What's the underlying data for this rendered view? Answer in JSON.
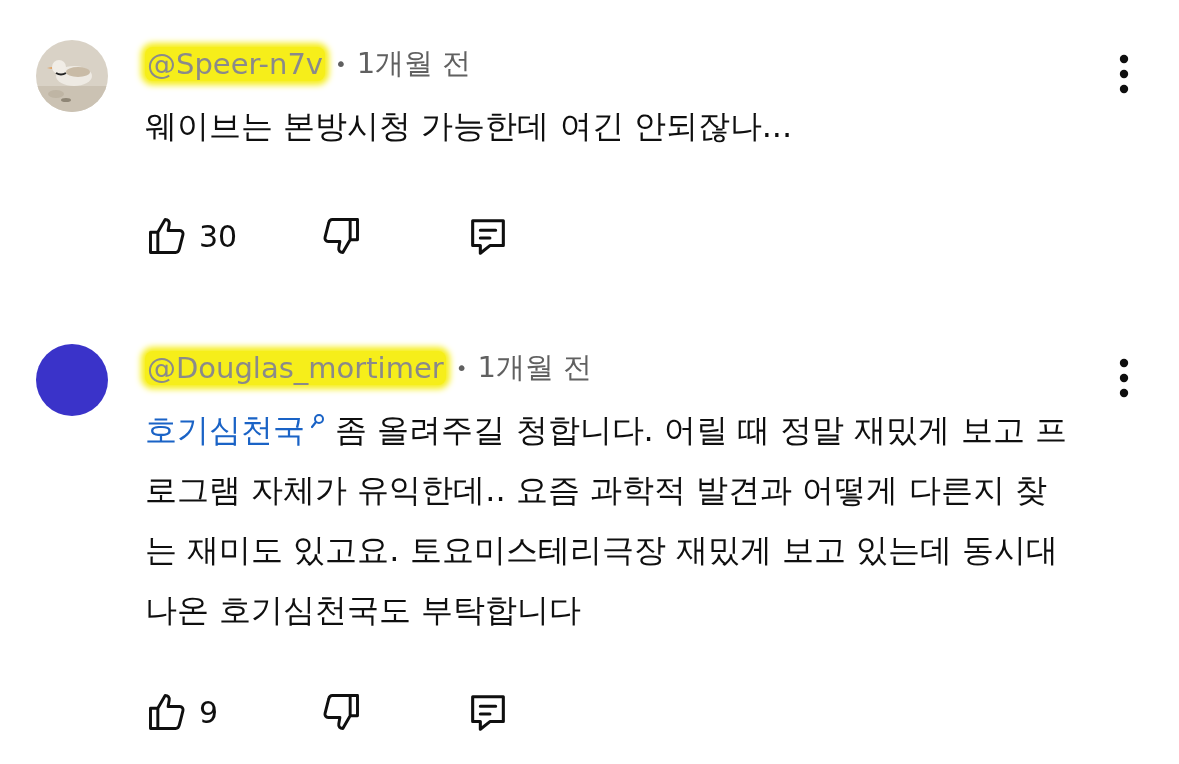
{
  "comments": [
    {
      "author": "@Speer-n7v",
      "time": "1개월 전",
      "avatar": {
        "kind": "picture"
      },
      "body": [
        {
          "kind": "text",
          "text": "웨이브는 본방시청 가능한데 여긴 안되잖나..."
        }
      ],
      "likes": "30"
    },
    {
      "author": "@Douglas_mortimer",
      "time": "1개월 전",
      "avatar": {
        "kind": "plain",
        "color": "#3a33c9"
      },
      "body": [
        {
          "kind": "link",
          "text": "호기심천국"
        },
        {
          "kind": "text",
          "text": " 좀 올려주길 청합니다. 어릴 때 정말 재밌게 보고 프로그램 자체가 유익한데.. 요즘 과학적 발견과 어떻게 다른지 찾는 재미도 있고요. 토요미스테리극장 재밌게 보고 있는데 동시대 나온 호기심천국도 부탁합니다"
        }
      ],
      "likes": "9"
    }
  ],
  "separator": "•"
}
